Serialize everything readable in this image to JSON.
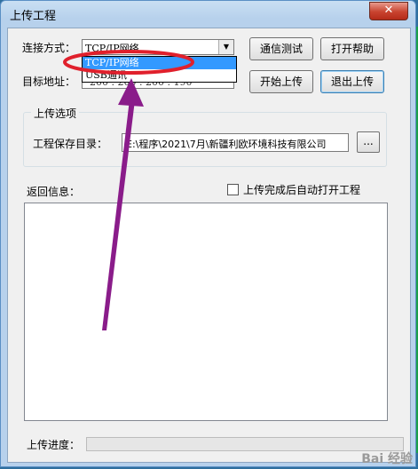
{
  "window": {
    "title": "上传工程",
    "close_icon": "close-icon"
  },
  "connection": {
    "label": "连接方式：",
    "value": "TCP/IP网络",
    "options": [
      "TCP/IP网络",
      "USB通讯"
    ]
  },
  "target": {
    "label": "目标地址：",
    "value": "200 . 200 . 200 . 190"
  },
  "buttons": {
    "test": "通信测试",
    "help": "打开帮助",
    "start": "开始上传",
    "exit": "退出上传"
  },
  "upload_options": {
    "title": "上传选项",
    "dir_label": "工程保存目录：",
    "dir_value": "E:\\程序\\2021\\7月\\新疆利欧环境科技有限公司",
    "browse_label": "..."
  },
  "feedback": {
    "label": "返回信息：",
    "checkbox_label": "上传完成后自动打开工程",
    "checked": false
  },
  "progress": {
    "label": "上传进度：",
    "value": 0
  },
  "watermark": "Bai 经验",
  "colors": {
    "annotation_ellipse": "#e0202c",
    "annotation_arrow": "#8a1c8a",
    "selection": "#3399ff"
  }
}
